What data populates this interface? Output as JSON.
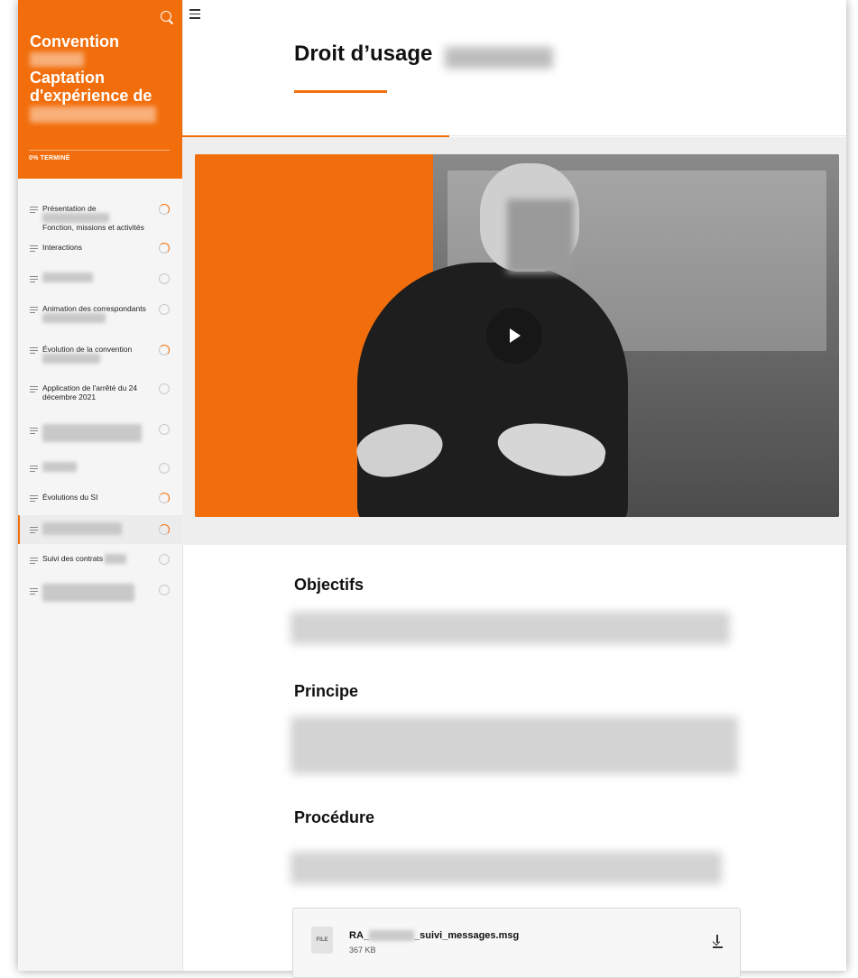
{
  "sidebar": {
    "course_title_line1": "Convention",
    "course_title_line2": "Captation",
    "course_title_line3": "d'expérience de",
    "progress_label": "0% TERMINÉ",
    "lessons": [
      {
        "label_a": "Présentation de",
        "label_b": "Fonction, missions et activités",
        "status": "partial"
      },
      {
        "label_a": "Interactions",
        "status": "partial"
      },
      {
        "label_a": "",
        "status": "empty"
      },
      {
        "label_a": "Animation des correspondants",
        "status": "empty"
      },
      {
        "label_a": "Évolution de la convention",
        "status": "partial"
      },
      {
        "label_a": "Application de l'arrêté du 24 décembre 2021",
        "status": "empty"
      },
      {
        "label_a": "",
        "status": "empty"
      },
      {
        "label_a": "",
        "status": "empty"
      },
      {
        "label_a": "Évolutions du SI",
        "status": "partial"
      },
      {
        "label_a": "",
        "status": "partial"
      },
      {
        "label_a": "Suivi des contrats",
        "status": "empty"
      },
      {
        "label_a": "",
        "status": "empty"
      }
    ]
  },
  "main": {
    "lesson_title": "Droit d’usage",
    "sections": {
      "objectifs": "Objectifs",
      "principe": "Principe",
      "procedure": "Procédure"
    },
    "attachment": {
      "file_badge": "FILE",
      "name_prefix": "RA_",
      "name_suffix": "_suivi_messages.msg",
      "size": "367 KB"
    }
  },
  "colors": {
    "accent": "#f26e0c",
    "sidebar_bg": "#f5f5f5",
    "video_band": "#eeeeee"
  }
}
